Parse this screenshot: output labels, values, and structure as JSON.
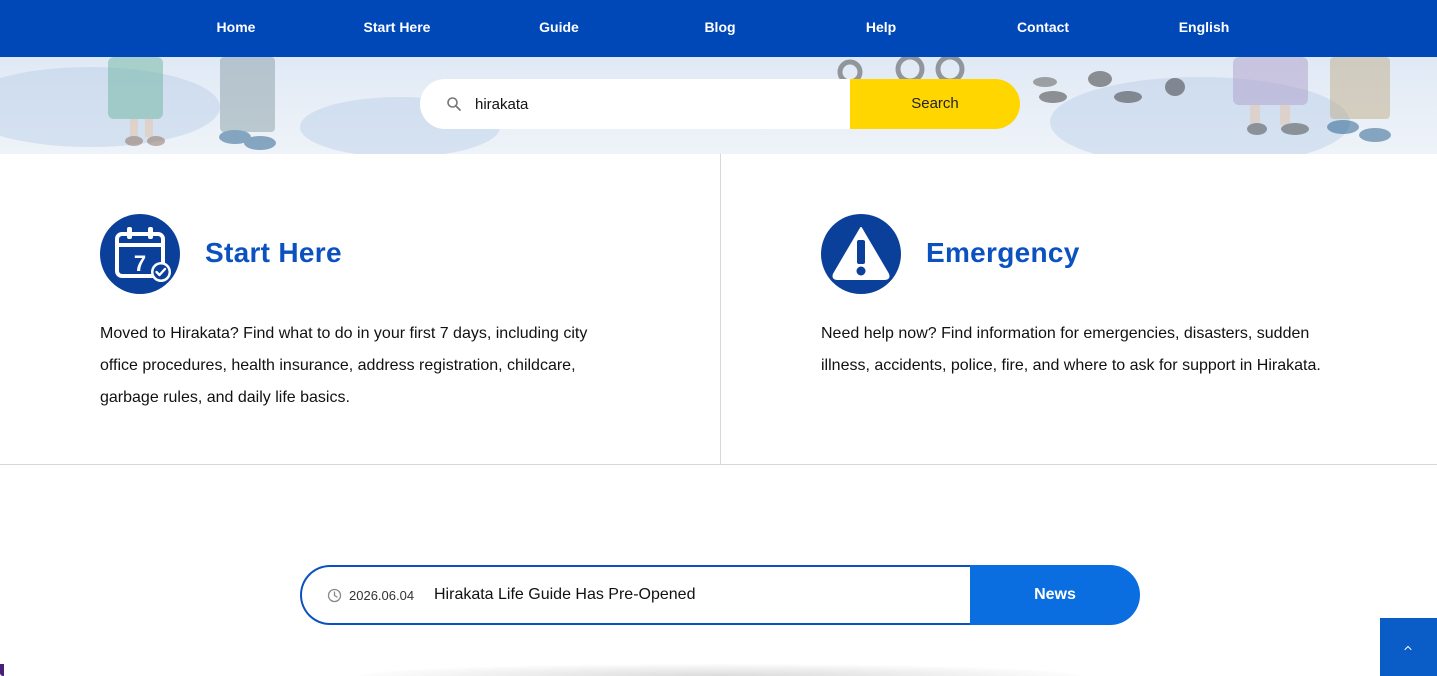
{
  "nav": {
    "items": [
      {
        "label": "Home"
      },
      {
        "label": "Start Here"
      },
      {
        "label": "Guide"
      },
      {
        "label": "Blog"
      },
      {
        "label": "Help"
      },
      {
        "label": "Contact"
      },
      {
        "label": "English"
      }
    ]
  },
  "search": {
    "value": "hirakata",
    "button_label": "Search",
    "icon": "search-icon"
  },
  "cards": [
    {
      "icon": "calendar-7-check-icon",
      "icon_text": "7",
      "title": "Start Here",
      "text": "Moved to Hirakata? Find what to do in your first 7 days, including city office procedures, health insurance, address registration, childcare, garbage rules, and daily life basics."
    },
    {
      "icon": "warning-triangle-icon",
      "title": "Emergency",
      "text": "Need help now? Find information for emergencies, disasters, sudden illness, accidents, police, fire, and where to ask for support in Hirakata."
    }
  ],
  "news": {
    "date": "2026.06.04",
    "title": "Hirakata Life Guide Has Pre-Opened",
    "button_label": "News",
    "icon": "clock-icon"
  },
  "colors": {
    "nav_bg": "#0048b8",
    "search_button": "#ffd600",
    "card_title": "#0b52c0",
    "icon_circle": "#0a3f9a",
    "news_button": "#0a6ee0"
  }
}
